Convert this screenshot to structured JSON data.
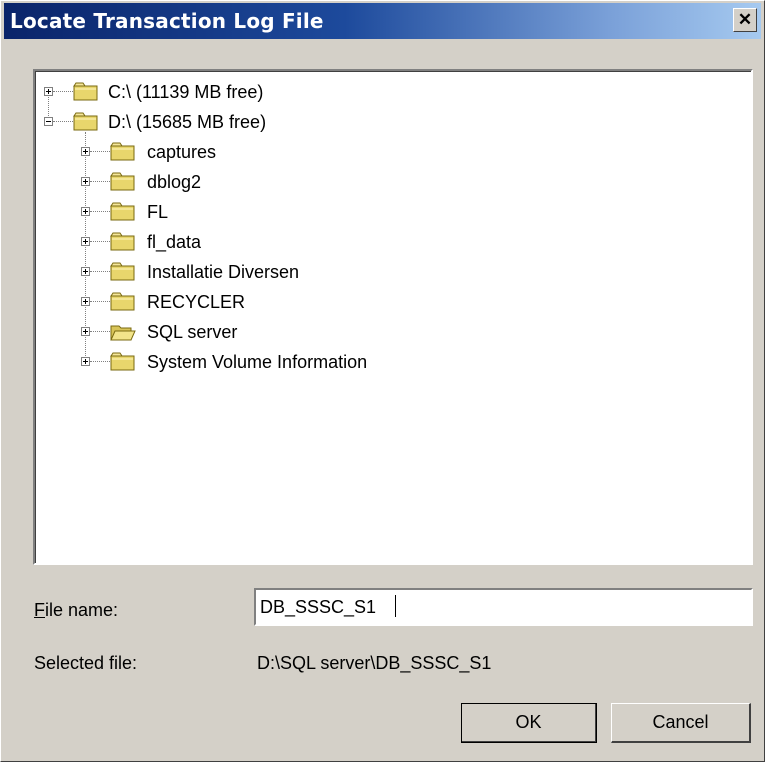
{
  "window": {
    "title": "Locate Transaction Log File",
    "close_glyph": "✕"
  },
  "tree": {
    "drives": [
      {
        "label": "C:\\ (11139 MB free)",
        "expander": "+",
        "icon": "folder-icon"
      },
      {
        "label": "D:\\ (15685 MB free)",
        "expander": "-",
        "icon": "folder-icon"
      }
    ],
    "folders": [
      {
        "label": "captures",
        "icon": "folder-icon"
      },
      {
        "label": "dblog2",
        "icon": "folder-icon"
      },
      {
        "label": "FL",
        "icon": "folder-icon"
      },
      {
        "label": "fl_data",
        "icon": "folder-icon"
      },
      {
        "label": "Installatie Diversen",
        "icon": "folder-icon"
      },
      {
        "label": "RECYCLER",
        "icon": "folder-icon"
      },
      {
        "label": "SQL server",
        "icon": "folder-open-icon"
      },
      {
        "label": "System Volume Information",
        "icon": "folder-icon"
      }
    ]
  },
  "form": {
    "file_name_mnemonic": "F",
    "file_name_label_rest": "ile name:",
    "file_name_value": "DB_SSSC_S1",
    "selected_file_label": "Selected file:",
    "selected_file_value": "D:\\SQL server\\DB_SSSC_S1"
  },
  "buttons": {
    "ok_label": "OK",
    "cancel_label": "Cancel"
  }
}
